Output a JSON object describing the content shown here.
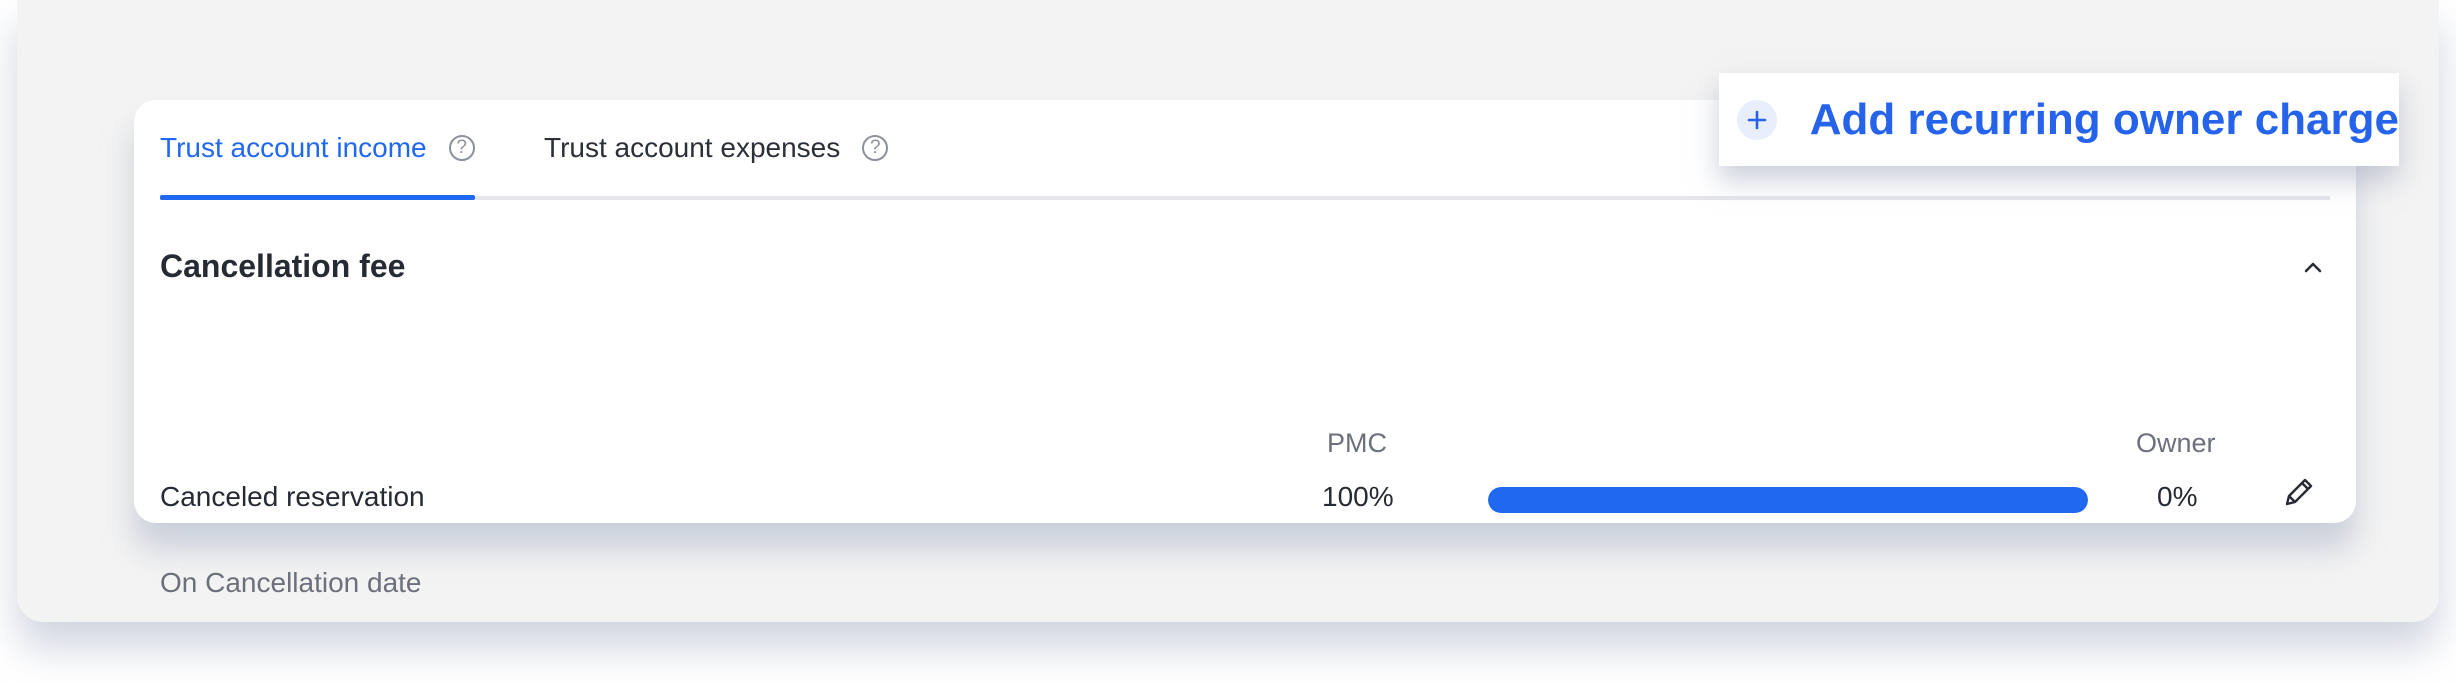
{
  "tabs": [
    {
      "label": "Trust account income",
      "active": true
    },
    {
      "label": "Trust account expenses",
      "active": false
    }
  ],
  "help_glyph": "?",
  "section": {
    "title": "Cancellation fee",
    "columns": {
      "left": "PMC",
      "right": "Owner"
    },
    "rule": {
      "label": "Canceled reservation",
      "pmc_percent": "100%",
      "owner_percent": "0%",
      "split_fraction_pmc": 1.0,
      "timing": "On Cancellation date"
    }
  },
  "add_button": {
    "label": "Add recurring owner charge"
  },
  "icons": {
    "help": "question-circle-icon",
    "collapse": "chevron-up-icon",
    "edit": "pencil-icon",
    "add": "plus-icon"
  },
  "colors": {
    "accent": "#2168f0",
    "track": "#e4e6ea",
    "text": "#262a33",
    "muted": "#6b707c"
  }
}
